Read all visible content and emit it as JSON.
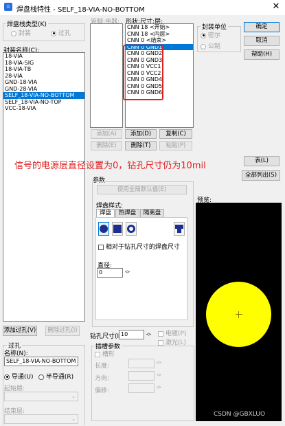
{
  "window": {
    "title": "焊盘栈特性 - SELF_18-VIA-NO-BOTTOM",
    "close_glyph": "✕"
  },
  "stack_type": {
    "label": "焊盘栈类型(K)",
    "options": [
      "封装",
      "过孔"
    ],
    "selected": "过孔"
  },
  "package_names": {
    "label": "封装名称(C):",
    "items": [
      "18-VIA",
      "18-VIA-SIG",
      "18-VIA-TB",
      "28-VIA",
      "GND-18-VIA",
      "GND-28-VIA",
      "SELF_18-VIA-NO-BOTTOM",
      "SELF_18-VIA-NO-TOP",
      "VCC-18-VIA"
    ],
    "selected_index": 6
  },
  "pins": {
    "label": "管脚:电器:"
  },
  "shapes": {
    "label": "形状:尺寸:层:",
    "items": [
      "CNN 18 <开始>",
      "CNN 18 <内层>",
      "CNN 0 <结束>",
      "CNN 0 GND1",
      "CNN 0 GND2",
      "CNN 0 GND3",
      "CNN 0 VCC1",
      "CNN 0 VCC2",
      "CNN 0 GND4",
      "CNN 0 GND5",
      "CNN 0 GND6"
    ],
    "selected_index": 3
  },
  "units": {
    "label": "封装单位",
    "options": [
      "密尔",
      "公制"
    ],
    "selected": "密尔"
  },
  "dialog_buttons": {
    "ok": "确定",
    "cancel": "取消",
    "help": "帮助(H)"
  },
  "pin_buttons": {
    "add": "添加(A)",
    "delete": "删除(E)"
  },
  "layer_buttons": {
    "add": "添加(D)",
    "copy": "复制(C)",
    "delete": "删除(T)",
    "paste": "粘贴(P)"
  },
  "annotation": "信号的电源层直径设置为0，钻孔尺寸仍为10mil",
  "table_button": "表(L)",
  "list_all_button": "全部列出(S)",
  "params": {
    "label": "参数",
    "use_global": "使用全局默认值(E)",
    "pad_style_label": "焊盘样式:",
    "tabs": [
      "焊盘",
      "热焊盘",
      "隔离盘"
    ],
    "relative_drill": "相对于钻孔尺寸的焊盘尺寸",
    "diameter_label": "直径:",
    "diameter_value": "0"
  },
  "preview": {
    "label": "预览:",
    "pad_color": "#ffff00",
    "watermark": "CSDN @GBXLUO"
  },
  "via_buttons": {
    "add": "添加过孔(V)",
    "delete": "删除过孔(I)"
  },
  "via_group": {
    "label": "过孔",
    "name_label": "名称(N):",
    "name_value": "SELF_18-VIA-NO-BOTTOM",
    "options": [
      "导通(U)",
      "半导通(R)"
    ],
    "selected": "导通(U)",
    "start_layer_label": "起始层:",
    "end_layer_label": "结束层:"
  },
  "drill": {
    "label": "钻孔尺寸(I):",
    "value": "10",
    "plated_label": "电镀(P)",
    "laser_label": "激光(L)"
  },
  "slot": {
    "label": "插槽参数",
    "slot_check": "槽形",
    "length_label": "长度:",
    "direction_label": "方向:",
    "offset_label": "偏移:"
  }
}
